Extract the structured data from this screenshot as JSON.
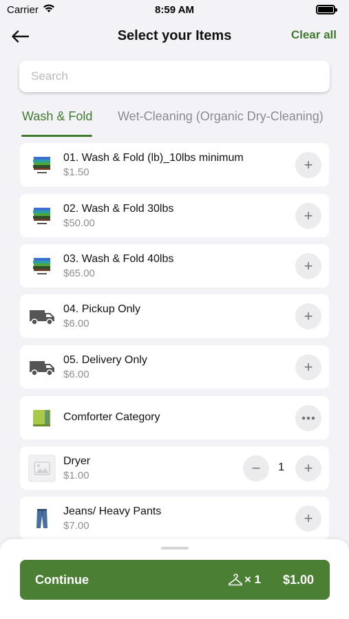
{
  "status_bar": {
    "carrier": "Carrier",
    "time": "8:59 AM"
  },
  "nav": {
    "title": "Select your Items",
    "clear_all": "Clear all"
  },
  "search": {
    "placeholder": "Search",
    "value": ""
  },
  "tabs": [
    {
      "label": "Wash & Fold",
      "active": true
    },
    {
      "label": "Wet-Cleaning (Organic Dry-Cleaning)",
      "active": false
    }
  ],
  "items": [
    {
      "name": "01. Wash & Fold (lb)_10lbs minimum",
      "price": "$1.50",
      "icon": "folded-clothes-icon"
    },
    {
      "name": "02. Wash & Fold 30lbs",
      "price": "$50.00",
      "icon": "folded-clothes-icon"
    },
    {
      "name": "03. Wash & Fold 40lbs",
      "price": "$65.00",
      "icon": "folded-clothes-icon"
    },
    {
      "name": "04. Pickup Only",
      "price": "$6.00",
      "icon": "van-icon"
    },
    {
      "name": "05. Delivery Only",
      "price": "$6.00",
      "icon": "van-icon"
    },
    {
      "name": "Comforter Category",
      "price": "",
      "icon": "comforter-icon",
      "action": "more"
    },
    {
      "name": "Dryer",
      "price": "$1.00",
      "icon": "image-placeholder-icon",
      "quantity": "1"
    },
    {
      "name": "Jeans/ Heavy Pants",
      "price": "$7.00",
      "icon": "jeans-icon"
    }
  ],
  "cart": {
    "continue_label": "Continue",
    "count": "× 1",
    "total": "$1.00"
  },
  "colors": {
    "accent": "#3f7a2c",
    "button": "#4a7f34",
    "background": "#f2f2f7"
  }
}
